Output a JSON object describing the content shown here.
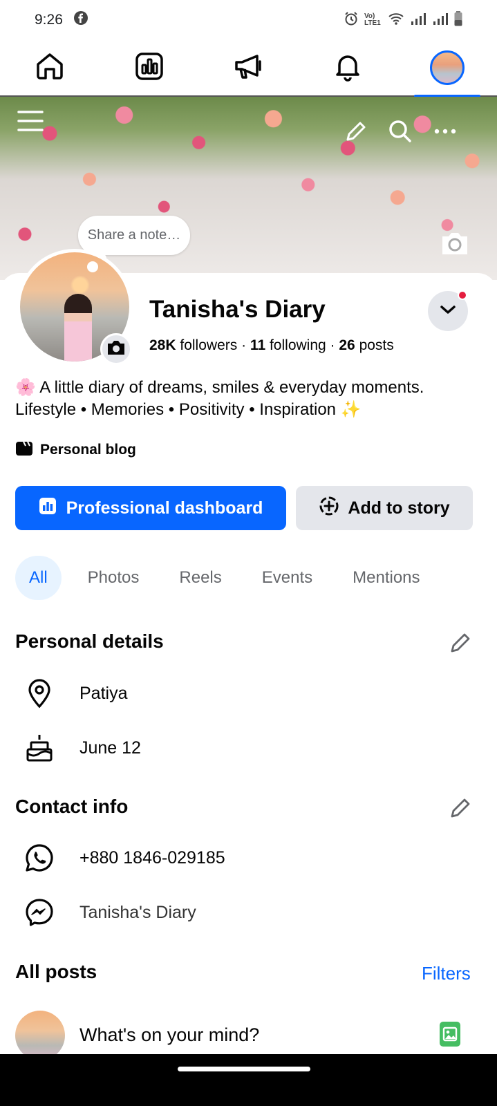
{
  "status_bar": {
    "time": "9:26",
    "icons": [
      "facebook-icon",
      "alarm-icon",
      "volte-icon",
      "wifi-icon",
      "signal-icon",
      "signal-icon",
      "battery-icon"
    ],
    "volte_label": "Vo) LTE1"
  },
  "top_nav": {
    "items": [
      "home-icon",
      "dashboard-icon",
      "megaphone-icon",
      "bell-icon",
      "profile-avatar"
    ],
    "active": "profile-avatar"
  },
  "cover": {
    "note_placeholder": "Share a note…"
  },
  "profile": {
    "name": "Tanisha's Diary",
    "followers_count": "28K",
    "followers_label": "followers",
    "following_count": "11",
    "following_label": "following",
    "posts_count": "26",
    "posts_label": "posts",
    "bio_line1": "🌸 A little diary of dreams, smiles & everyday moments.",
    "bio_line2": "Lifestyle • Memories • Positivity • Inspiration ✨",
    "category": "Personal blog"
  },
  "actions": {
    "primary_label": "Professional dashboard",
    "secondary_label": "Add to story"
  },
  "tabs": [
    {
      "label": "All",
      "active": true
    },
    {
      "label": "Photos",
      "active": false
    },
    {
      "label": "Reels",
      "active": false
    },
    {
      "label": "Events",
      "active": false
    },
    {
      "label": "Mentions",
      "active": false
    }
  ],
  "personal_details": {
    "title": "Personal details",
    "location": "Patiya",
    "birthday": "June 12"
  },
  "contact_info": {
    "title": "Contact info",
    "phone": "+880 1846-029185",
    "messenger": "Tanisha's Diary"
  },
  "posts": {
    "title": "All posts",
    "filters_label": "Filters",
    "composer_placeholder": "What's on your mind?"
  },
  "colors": {
    "accent": "#0866ff",
    "secondary_button": "#e4e6eb",
    "notification_dot": "#e41e3f",
    "photo_icon": "#45bd62"
  }
}
